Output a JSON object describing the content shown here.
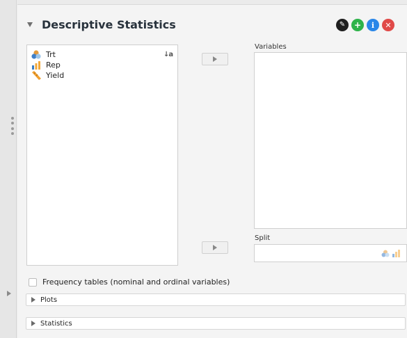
{
  "analysis": {
    "title": "Descriptive Statistics"
  },
  "header_icons": [
    {
      "name": "edit-icon",
      "glyph": "✎"
    },
    {
      "name": "add-icon",
      "glyph": "+"
    },
    {
      "name": "info-icon",
      "glyph": "i"
    },
    {
      "name": "close-icon",
      "glyph": "✕"
    }
  ],
  "source_variables": [
    {
      "label": "Trt",
      "type": "nominal"
    },
    {
      "label": "Rep",
      "type": "ordinal"
    },
    {
      "label": "Yield",
      "type": "scale"
    }
  ],
  "sort_glyph": "↓a",
  "targets": {
    "variables_label": "Variables",
    "split_label": "Split"
  },
  "options": {
    "frequency_tables_label": "Frequency tables (nominal and ordinal variables)",
    "frequency_tables_checked": false
  },
  "sections": [
    {
      "label": "Plots"
    },
    {
      "label": "Statistics"
    }
  ],
  "colors": {
    "nominal": "#e39a3c",
    "ordinal_bars": "#f2a93b",
    "ordinal_bar_dark": "#3a7ec6",
    "scale": "#f0a030",
    "accent_green": "#2eb34a",
    "accent_blue": "#2a87e8",
    "accent_red": "#e04a48"
  }
}
